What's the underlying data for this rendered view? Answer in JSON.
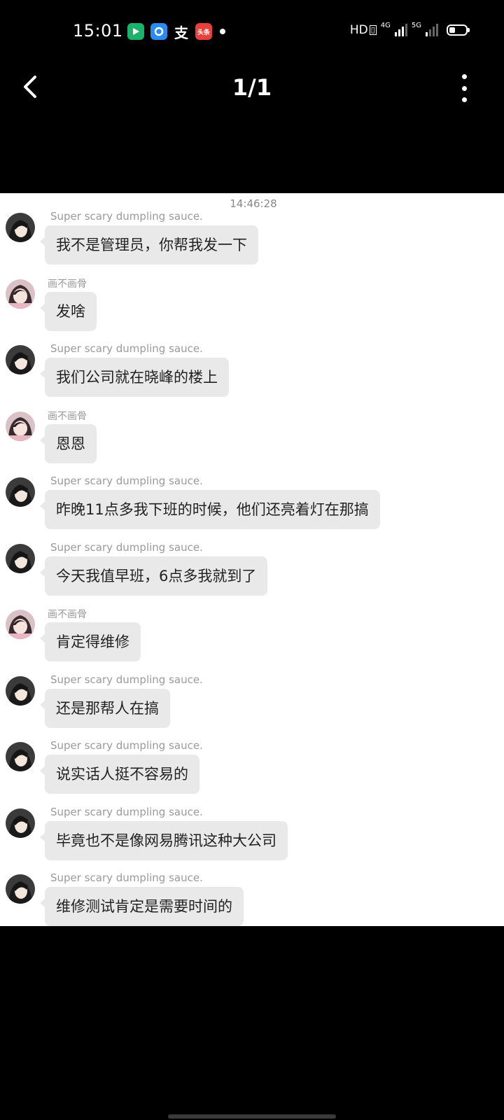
{
  "status_bar": {
    "time": "15:01",
    "hd_label": "HD",
    "net1": "4G",
    "net2": "5G",
    "news_label": "头条",
    "pay_label": "支",
    "battery_level": 0.35
  },
  "header": {
    "page_indicator": "1/1"
  },
  "chat": {
    "timestamp": "14:46:28",
    "messages": [
      {
        "sender": "Super scary dumpling sauce.",
        "text": "我不是管理员，你帮我发一下"
      },
      {
        "sender": "画不画骨",
        "text": "发啥"
      },
      {
        "sender": "Super scary dumpling sauce.",
        "text": "我们公司就在晓峰的楼上"
      },
      {
        "sender": "画不画骨",
        "text": "恩恩"
      },
      {
        "sender": "Super scary dumpling sauce.",
        "text": "昨晚11点多我下班的时候，他们还亮着灯在那搞"
      },
      {
        "sender": "Super scary dumpling sauce.",
        "text": "今天我值早班，6点多我就到了"
      },
      {
        "sender": "画不画骨",
        "text": "肯定得维修"
      },
      {
        "sender": "Super scary dumpling sauce.",
        "text": "还是那帮人在搞"
      },
      {
        "sender": "Super scary dumpling sauce.",
        "text": "说实话人挺不容易的"
      },
      {
        "sender": "Super scary dumpling sauce.",
        "text": "毕竟也不是像网易腾讯这种大公司"
      },
      {
        "sender": "Super scary dumpling sauce.",
        "text": "维修测试肯定是需要时间的"
      }
    ]
  }
}
